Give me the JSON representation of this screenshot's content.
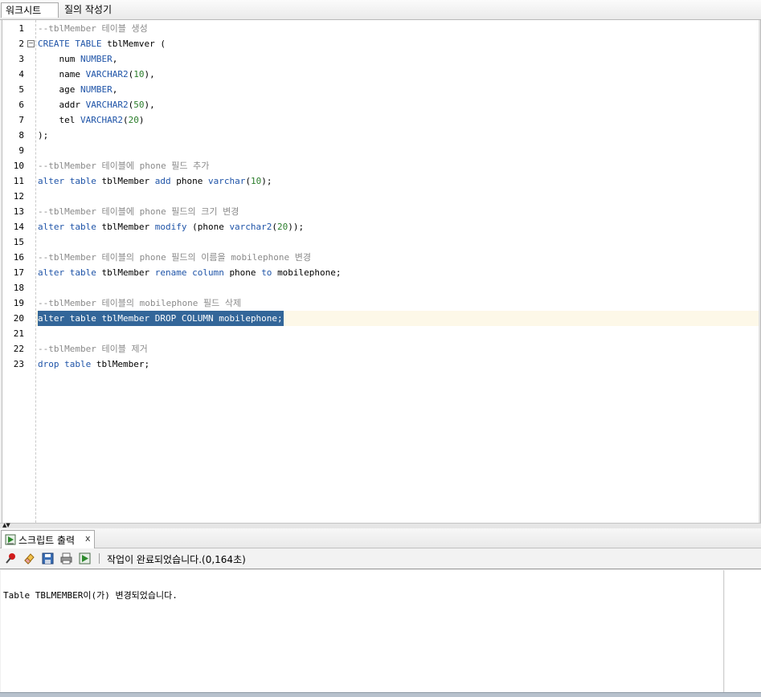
{
  "tabs": [
    {
      "label": "워크시트",
      "active": true
    },
    {
      "label": "질의 작성기",
      "active": false
    }
  ],
  "editor": {
    "current_line": 20,
    "lines": [
      {
        "n": 1,
        "tokens": [
          {
            "t": "--tblMember 테이블 생성",
            "c": "cm"
          }
        ]
      },
      {
        "n": 2,
        "tokens": [
          {
            "t": "CREATE TABLE ",
            "c": "kw"
          },
          {
            "t": "tblMemver (",
            "c": "id"
          }
        ]
      },
      {
        "n": 3,
        "tokens": [
          {
            "t": "    num ",
            "c": "id"
          },
          {
            "t": "NUMBER",
            "c": "kw"
          },
          {
            "t": ",",
            "c": "id"
          }
        ]
      },
      {
        "n": 4,
        "tokens": [
          {
            "t": "    name ",
            "c": "id"
          },
          {
            "t": "VARCHAR2",
            "c": "kw"
          },
          {
            "t": "(",
            "c": "id"
          },
          {
            "t": "10",
            "c": "num"
          },
          {
            "t": "),",
            "c": "id"
          }
        ]
      },
      {
        "n": 5,
        "tokens": [
          {
            "t": "    age ",
            "c": "id"
          },
          {
            "t": "NUMBER",
            "c": "kw"
          },
          {
            "t": ",",
            "c": "id"
          }
        ]
      },
      {
        "n": 6,
        "tokens": [
          {
            "t": "    addr ",
            "c": "id"
          },
          {
            "t": "VARCHAR2",
            "c": "kw"
          },
          {
            "t": "(",
            "c": "id"
          },
          {
            "t": "50",
            "c": "num"
          },
          {
            "t": "),",
            "c": "id"
          }
        ]
      },
      {
        "n": 7,
        "tokens": [
          {
            "t": "    tel ",
            "c": "id"
          },
          {
            "t": "VARCHAR2",
            "c": "kw"
          },
          {
            "t": "(",
            "c": "id"
          },
          {
            "t": "20",
            "c": "num"
          },
          {
            "t": ")",
            "c": "id"
          }
        ]
      },
      {
        "n": 8,
        "tokens": [
          {
            "t": ");",
            "c": "id"
          }
        ]
      },
      {
        "n": 9,
        "tokens": []
      },
      {
        "n": 10,
        "tokens": [
          {
            "t": "--tblMember 테이블에 phone 필드 추가",
            "c": "cm"
          }
        ]
      },
      {
        "n": 11,
        "tokens": [
          {
            "t": "alter table ",
            "c": "kw"
          },
          {
            "t": "tblMember ",
            "c": "id"
          },
          {
            "t": "add ",
            "c": "kw"
          },
          {
            "t": "phone ",
            "c": "id"
          },
          {
            "t": "varchar",
            "c": "kw"
          },
          {
            "t": "(",
            "c": "id"
          },
          {
            "t": "10",
            "c": "num"
          },
          {
            "t": ");",
            "c": "id"
          }
        ]
      },
      {
        "n": 12,
        "tokens": []
      },
      {
        "n": 13,
        "tokens": [
          {
            "t": "--tblMember 테이블에 phone 필드의 크기 변경",
            "c": "cm"
          }
        ]
      },
      {
        "n": 14,
        "tokens": [
          {
            "t": "alter table ",
            "c": "kw"
          },
          {
            "t": "tblMember ",
            "c": "id"
          },
          {
            "t": "modify ",
            "c": "kw"
          },
          {
            "t": "(phone ",
            "c": "id"
          },
          {
            "t": "varchar2",
            "c": "kw"
          },
          {
            "t": "(",
            "c": "id"
          },
          {
            "t": "20",
            "c": "num"
          },
          {
            "t": "));",
            "c": "id"
          }
        ]
      },
      {
        "n": 15,
        "tokens": []
      },
      {
        "n": 16,
        "tokens": [
          {
            "t": "--tblMember 테이블의 phone 필드의 이름을 mobilephone 변경",
            "c": "cm"
          }
        ]
      },
      {
        "n": 17,
        "tokens": [
          {
            "t": "alter table ",
            "c": "kw"
          },
          {
            "t": "tblMember ",
            "c": "id"
          },
          {
            "t": "rename column ",
            "c": "kw"
          },
          {
            "t": "phone ",
            "c": "id"
          },
          {
            "t": "to ",
            "c": "kw"
          },
          {
            "t": "mobilephone;",
            "c": "id"
          }
        ]
      },
      {
        "n": 18,
        "tokens": []
      },
      {
        "n": 19,
        "tokens": [
          {
            "t": "--tblMember 테이블의 mobilephone 필드 삭제",
            "c": "cm"
          }
        ]
      },
      {
        "n": 20,
        "selected": true,
        "tokens": [
          {
            "t": "alter table ",
            "c": "kw"
          },
          {
            "t": "tblMember ",
            "c": "id"
          },
          {
            "t": "DROP COLUMN ",
            "c": "kw"
          },
          {
            "t": "mobilephone;",
            "c": "id"
          }
        ]
      },
      {
        "n": 21,
        "tokens": []
      },
      {
        "n": 22,
        "tokens": [
          {
            "t": "--tblMember 테이블 제거",
            "c": "cm"
          }
        ]
      },
      {
        "n": 23,
        "tokens": [
          {
            "t": "drop table ",
            "c": "kw"
          },
          {
            "t": "tblMember;",
            "c": "id"
          }
        ]
      }
    ]
  },
  "output_panel": {
    "tab_label": "스크립트 출력",
    "close_label": "x",
    "status": "작업이 완료되었습니다.(0,164초)",
    "toolbar_icons": [
      "pin-icon",
      "eraser-icon",
      "save-icon",
      "print-icon",
      "run-script-icon"
    ],
    "text": "Table TBLMEMBER이(가) 변경되었습니다."
  }
}
